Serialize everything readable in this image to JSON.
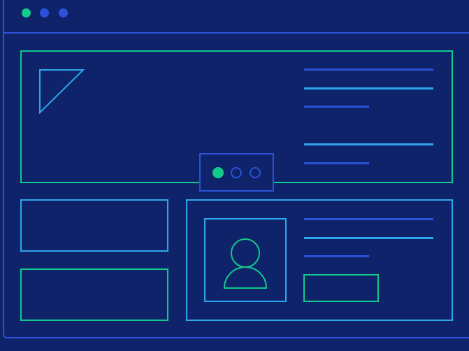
{
  "colors": {
    "background": "#0f236a",
    "frame": "#2b52d8",
    "accent_green": "#13c98c",
    "accent_cyan": "#2ea7ea",
    "accent_blue": "#2b52d8"
  },
  "window": {
    "controls": [
      "close-dot",
      "minimize-dot",
      "maximize-dot"
    ]
  },
  "hero": {
    "image_icon": "image-triangle-icon",
    "carousel": {
      "slides": 3,
      "active_index": 0
    }
  },
  "profile_card": {
    "avatar_icon": "user-avatar-icon"
  }
}
